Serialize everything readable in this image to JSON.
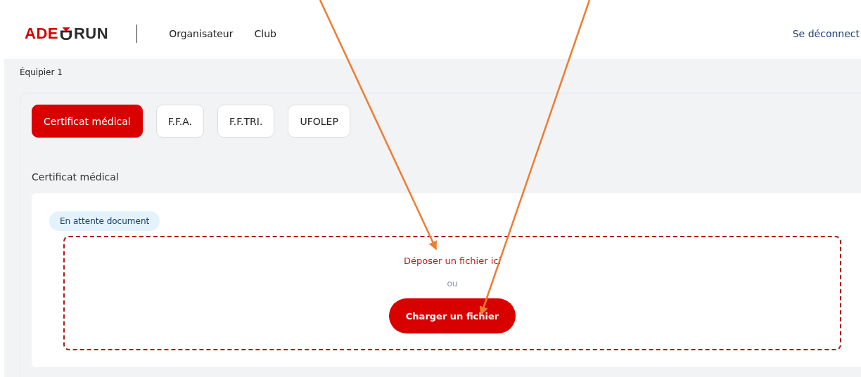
{
  "header": {
    "logo": {
      "left": "ADE",
      "right": "RUN"
    },
    "nav": [
      {
        "label": "Organisateur"
      },
      {
        "label": "Club"
      }
    ],
    "logout": "Se déconnect"
  },
  "section_title": "Équipier 1",
  "tabs": [
    {
      "label": "Certificat médical",
      "selected": true
    },
    {
      "label": "F.F.A.",
      "selected": false
    },
    {
      "label": "F.F.TRI.",
      "selected": false
    },
    {
      "label": "UFOLEP",
      "selected": false
    }
  ],
  "panel": {
    "title": "Certificat médical",
    "status": "En attente document",
    "dropzone": {
      "hint": "Déposer un fichier ici",
      "separator": "ou",
      "button": "Charger un fichier"
    }
  },
  "annotations": [
    {
      "kind": "arrow"
    },
    {
      "kind": "arrow"
    }
  ]
}
